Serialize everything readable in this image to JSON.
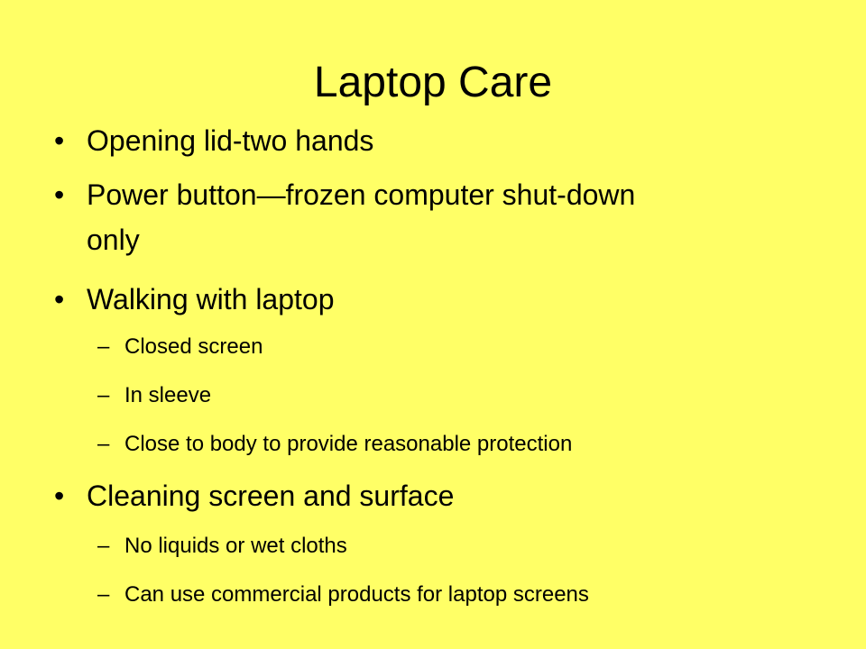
{
  "slide": {
    "title": "Laptop Care",
    "bullets": [
      {
        "text": "Opening lid-two hands"
      },
      {
        "line1": "Power button—frozen computer shut-down",
        "line2": "only"
      },
      {
        "text": "Walking with laptop",
        "subs": [
          "Closed screen",
          "In sleeve",
          "Close to body to provide reasonable protection"
        ]
      },
      {
        "text": "Cleaning screen and surface",
        "subs": [
          "No liquids or wet cloths",
          "Can use commercial products for laptop screens"
        ]
      }
    ],
    "bullet_glyph": "•",
    "sub_glyph": "–",
    "background_color": "#FFFF66"
  }
}
